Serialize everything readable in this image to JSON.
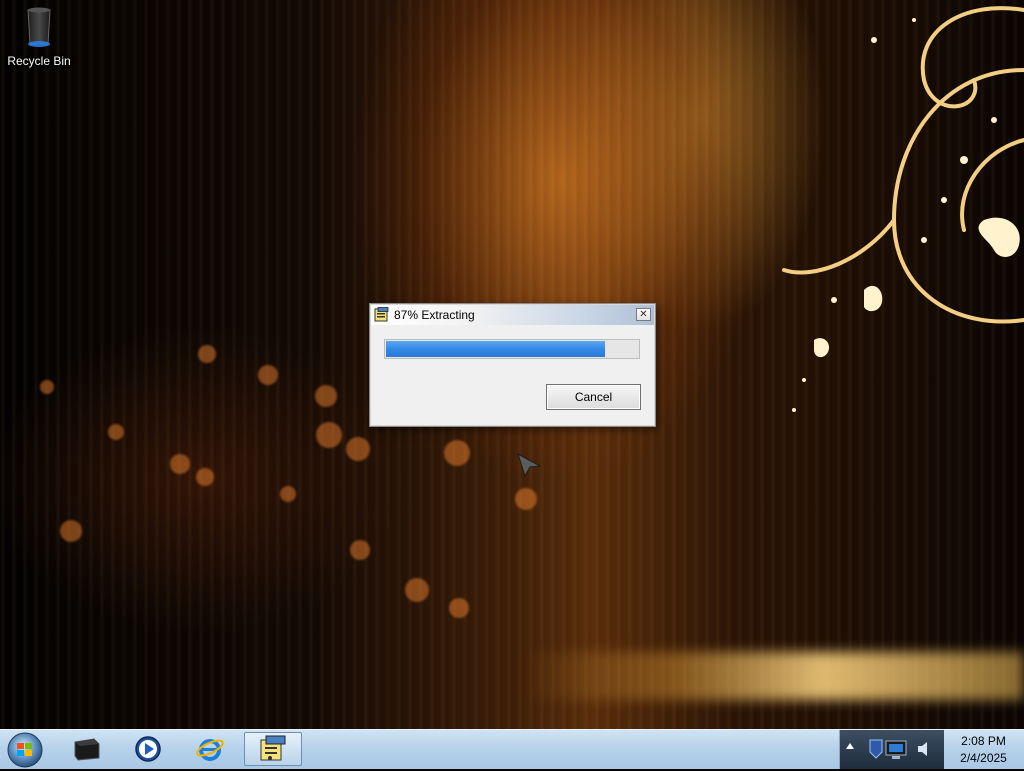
{
  "desktop": {
    "icons": [
      {
        "label": "Recycle Bin",
        "icon": "recycle-bin-icon"
      }
    ]
  },
  "dialog": {
    "title": "87% Extracting",
    "icon": "winzip-self-extractor-icon",
    "progress": 0.87,
    "cancel_label": "Cancel",
    "close_symbol": "✕"
  },
  "taskbar": {
    "start_icon": "windows-start-orb-icon",
    "pinned": [
      {
        "icon": "terminal-icon"
      },
      {
        "icon": "media-player-icon"
      },
      {
        "icon": "internet-explorer-icon"
      },
      {
        "icon": "self-extractor-app-icon",
        "active": true
      }
    ],
    "tray_icons": [
      "show-hidden-icons-arrow",
      "network-icon",
      "volume-icon"
    ],
    "time": "2:08 PM",
    "date": "2/4/2025"
  },
  "colors": {
    "progress_fill": "#3589e6",
    "taskbar": "#b7d2ea",
    "dialog_bg": "#f0f0f0"
  }
}
